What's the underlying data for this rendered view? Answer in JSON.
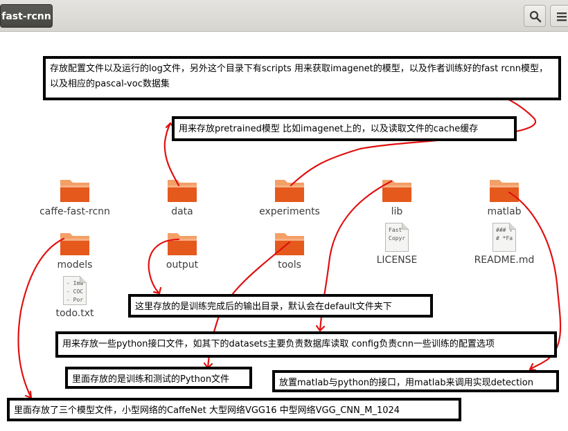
{
  "header": {
    "path_button": "fast-rcnn",
    "search_icon": "search-icon",
    "menu_icon": "hamburger-menu-icon"
  },
  "files": [
    {
      "name": "caffe-fast-rcnn",
      "type": "folder"
    },
    {
      "name": "data",
      "type": "folder"
    },
    {
      "name": "experiments",
      "type": "folder"
    },
    {
      "name": "lib",
      "type": "folder"
    },
    {
      "name": "matlab",
      "type": "folder"
    },
    {
      "name": "models",
      "type": "folder"
    },
    {
      "name": "output",
      "type": "folder"
    },
    {
      "name": "tools",
      "type": "folder"
    },
    {
      "name": "LICENSE",
      "type": "file",
      "preview": [
        "Fast",
        "Copyr"
      ]
    },
    {
      "name": "README.md",
      "type": "file",
      "preview": [
        "### T",
        "# *Fa"
      ]
    },
    {
      "name": "todo.txt",
      "type": "file",
      "preview": [
        "- Ima",
        "- COC",
        "- Por"
      ]
    }
  ],
  "annotations": {
    "experiments": "存放配置文件以及运行的log文件，另外这个目录下有scripts 用来获取imagenet的模型，以及作者训练好的fast rcnn模型，以及相应的pascal-voc数据集",
    "data": "用来存放pretrained模型 比如imagenet上的，以及读取文件的cache缓存",
    "output": "这里存放的是训练完成后的输出目录，默认会在default文件夹下",
    "lib": "用来存放一些python接口文件，如其下的datasets主要负责数据库读取 config负责cnn一些训练的配置选项",
    "tools": "里面存放的是训练和测试的Python文件",
    "matlab": "放置matlab与python的接口，用matlab来调用实现detection",
    "models": "里面存放了三个模型文件，小型网络的CaffeNet 大型网络VGG16 中型网络VGG_CNN_M_1024"
  },
  "colors": {
    "folder_top": "#f4a574",
    "folder_body": "#e5591d",
    "annotation_line": "#e01010",
    "header_button": "#4f4f4c"
  }
}
